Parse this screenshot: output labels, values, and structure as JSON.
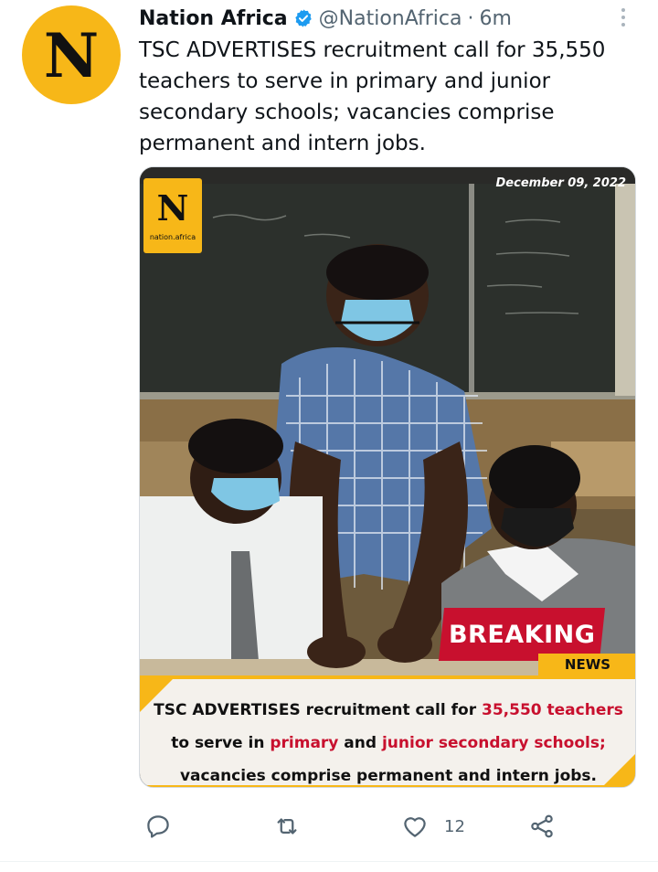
{
  "tweet": {
    "avatar_letter": "N",
    "author_name": "Nation Africa",
    "handle": "@NationAfrica",
    "separator": "·",
    "time": "6m",
    "text": "TSC ADVERTISES recruitment call for 35,550 teachers to serve in primary and junior secondary schools; vacancies comprise permanent and intern jobs."
  },
  "media": {
    "logo_letter": "N",
    "logo_domain": "nation.africa",
    "date": "December 09, 2022",
    "breaking_label": "BREAKING",
    "news_label": "NEWS",
    "caption": {
      "p1": "TSC ADVERTISES recruitment call for ",
      "p2": "35,550 teachers",
      "p3": " to serve in ",
      "p4": "primary",
      "p5": " and ",
      "p6": "junior secondary schools;",
      "p7": " vacancies comprise permanent and intern jobs."
    }
  },
  "actions": {
    "reply_icon": "reply-icon",
    "retweet_icon": "retweet-icon",
    "like_icon": "like-icon",
    "like_count": "12",
    "share_icon": "share-icon"
  },
  "colors": {
    "brand_yellow": "#f7b718",
    "breaking_red": "#c8102e",
    "verified_blue": "#1d9bf0",
    "muted_text": "#536471"
  }
}
